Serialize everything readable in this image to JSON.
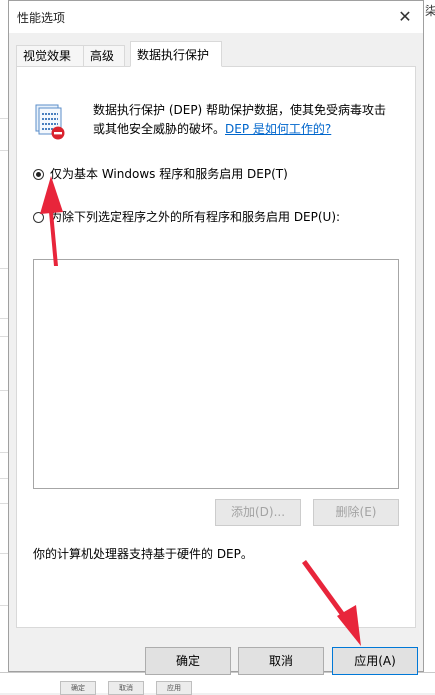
{
  "background": {
    "right_text": "柒",
    "bottom_buttons": [
      "确定",
      "取消",
      "应用"
    ]
  },
  "dialog": {
    "title": "性能选项",
    "close_icon": "close-icon",
    "tabs": [
      {
        "label": "视觉效果",
        "active": false
      },
      {
        "label": "高级",
        "active": false
      },
      {
        "label": "数据执行保护",
        "active": true
      }
    ],
    "description": "数据执行保护 (DEP) 帮助保护数据，使其免受病毒攻击或其他安全威胁的破坏。",
    "help_link": "DEP 是如何工作的?",
    "options": [
      {
        "label": "仅为基本 Windows 程序和服务启用 DEP(T)",
        "checked": true
      },
      {
        "label": "为除下列选定程序之外的所有程序和服务启用 DEP(U):",
        "checked": false
      }
    ],
    "add_button": "添加(D)...",
    "remove_button": "删除(E)",
    "note": "你的计算机处理器支持基于硬件的 DEP。",
    "ok_button": "确定",
    "cancel_button": "取消",
    "apply_button": "应用(A)"
  },
  "annotation_color": "#e8253b"
}
